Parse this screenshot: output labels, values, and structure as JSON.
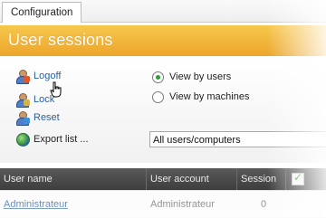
{
  "tabs": [
    {
      "label": "Configuration",
      "active": true
    }
  ],
  "banner": {
    "title": "User sessions",
    "color": "#eca62b"
  },
  "actions": [
    {
      "label": "Logoff",
      "icon": "user-logoff-icon",
      "style": "link"
    },
    {
      "label": "Lock",
      "icon": "user-lock-icon",
      "style": "link"
    },
    {
      "label": "Reset",
      "icon": "user-reset-icon",
      "style": "link"
    },
    {
      "label": "Export list ...",
      "icon": "globe-export-icon",
      "style": "plain"
    }
  ],
  "view_options": [
    {
      "label": "View by users",
      "selected": true
    },
    {
      "label": "View by machines",
      "selected": false
    }
  ],
  "filter": {
    "selected": "All users/computers"
  },
  "table": {
    "columns": [
      "User name",
      "User account",
      "Session"
    ],
    "rows": [
      {
        "user_name": "Administrateur",
        "user_account": "Administrateur",
        "session": "0"
      }
    ]
  },
  "colors": {
    "link": "#2a5f9e",
    "accent": "#eca62b",
    "header_bg": "#3d3d3d"
  }
}
